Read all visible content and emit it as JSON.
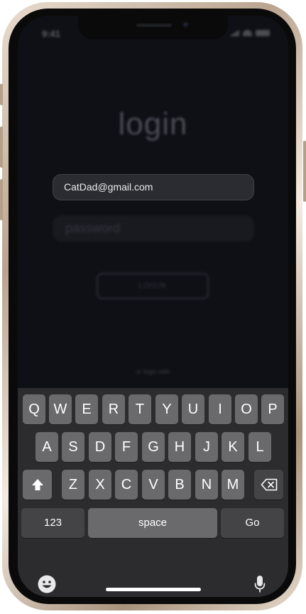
{
  "status_bar": {
    "time": "9:41"
  },
  "app": {
    "title": "login",
    "email_value": "CatDad@gmail.com",
    "password_placeholder": "password",
    "login_button": "LOGIN",
    "alt_login_text": "or login with"
  },
  "keyboard": {
    "row1": [
      "Q",
      "W",
      "E",
      "R",
      "T",
      "Y",
      "U",
      "I",
      "O",
      "P"
    ],
    "row2": [
      "A",
      "S",
      "D",
      "F",
      "G",
      "H",
      "J",
      "K",
      "L"
    ],
    "row3": [
      "Z",
      "X",
      "C",
      "V",
      "B",
      "N",
      "M"
    ],
    "numbers_key": "123",
    "space_key": "space",
    "go_key": "Go",
    "icons": [
      "shift-icon",
      "backspace-icon",
      "emoji-icon",
      "microphone-icon"
    ]
  },
  "colors": {
    "frame_gold": "#c9b6a2",
    "screen_bg": "#0e1016",
    "keyboard_bg": "#2c2c2e",
    "key_light": "#6a6a6d",
    "key_dark": "#444446"
  }
}
